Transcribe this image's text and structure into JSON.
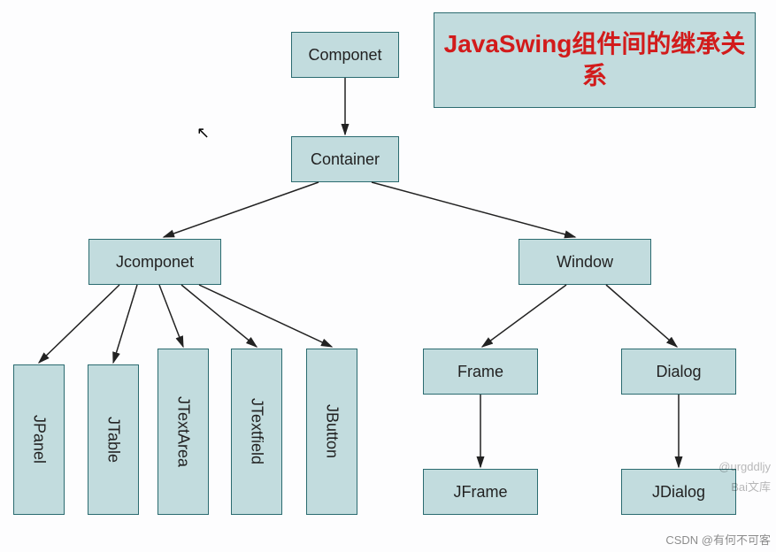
{
  "title": "JavaSwing组件间的继承关系",
  "nodes": {
    "componet": "Componet",
    "container": "Container",
    "jcomponet": "Jcomponet",
    "window": "Window",
    "jpanel": "JPanel",
    "jtable": "JTable",
    "jtextarea": "JTextArea",
    "jtextfield": "JTextfield",
    "jbutton": "JButton",
    "frame": "Frame",
    "dialog": "Dialog",
    "jframe": "JFrame",
    "jdialog": "JDialog"
  },
  "watermarks": {
    "w1": "@urgddljy",
    "w2": "Bai文库",
    "w3": "CSDN @有何不可客"
  },
  "chart_data": {
    "type": "tree",
    "title": "JavaSwing组件间的继承关系",
    "root": "Componet",
    "edges": [
      [
        "Componet",
        "Container"
      ],
      [
        "Container",
        "Jcomponet"
      ],
      [
        "Container",
        "Window"
      ],
      [
        "Jcomponet",
        "JPanel"
      ],
      [
        "Jcomponet",
        "JTable"
      ],
      [
        "Jcomponet",
        "JTextArea"
      ],
      [
        "Jcomponet",
        "JTextfield"
      ],
      [
        "Jcomponet",
        "JButton"
      ],
      [
        "Window",
        "Frame"
      ],
      [
        "Window",
        "Dialog"
      ],
      [
        "Frame",
        "JFrame"
      ],
      [
        "Dialog",
        "JDialog"
      ]
    ]
  }
}
